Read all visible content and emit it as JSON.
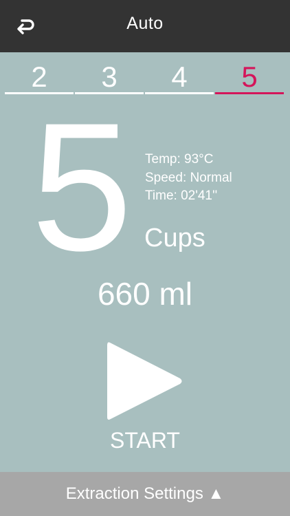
{
  "header": {
    "title": "Auto",
    "back_icon": "return-arrow-icon"
  },
  "cup_tabs": [
    {
      "label": "2",
      "active": false
    },
    {
      "label": "3",
      "active": false
    },
    {
      "label": "4",
      "active": false
    },
    {
      "label": "5",
      "active": true
    }
  ],
  "selection": {
    "cups_number": "5",
    "cups_label": "Cups",
    "temp": "Temp: 93°C",
    "speed": "Speed: Normal",
    "time": "Time: 02'41''",
    "volume": "660 ml"
  },
  "start": {
    "label": "START",
    "icon": "play-icon"
  },
  "footer": {
    "label": "Extraction Settings ▲"
  },
  "colors": {
    "background": "#a8bfbf",
    "topbar": "#333333",
    "accent": "#d4155a",
    "footer": "#a7a7a7"
  }
}
